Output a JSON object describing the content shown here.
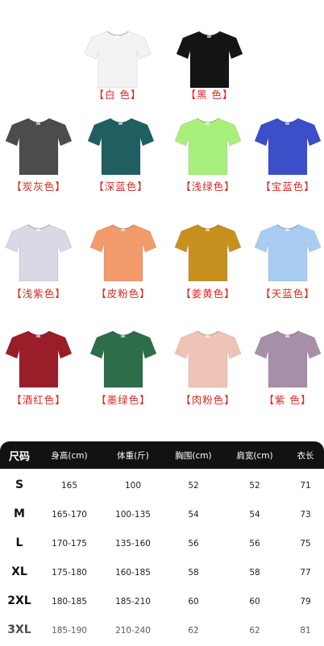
{
  "colors": [
    {
      "label": "【白 色】",
      "hex": "#f3f3f3"
    },
    {
      "label": "【黑 色】",
      "hex": "#141414"
    },
    {
      "label": "【炭灰色】",
      "hex": "#4c4c4c"
    },
    {
      "label": "【深蓝色】",
      "hex": "#1f5f62"
    },
    {
      "label": "【浅绿色】",
      "hex": "#a8ef7c"
    },
    {
      "label": "【宝蓝色】",
      "hex": "#3a4fc8"
    },
    {
      "label": "【浅紫色】",
      "hex": "#d8d8e6"
    },
    {
      "label": "【皮粉色】",
      "hex": "#f29a6a"
    },
    {
      "label": "【姜黄色】",
      "hex": "#c8901f"
    },
    {
      "label": "【天蓝色】",
      "hex": "#a9cdf2"
    },
    {
      "label": "【酒红色】",
      "hex": "#9a1d2a"
    },
    {
      "label": "【墨绿色】",
      "hex": "#2d6d4a"
    },
    {
      "label": "【肉粉色】",
      "hex": "#efc4b6"
    },
    {
      "label": "【紫 色】",
      "hex": "#a88fa8"
    }
  ],
  "size_table": {
    "headers": [
      "尺码",
      "身高(cm)",
      "体重(斤)",
      "胸围(cm)",
      "肩宽(cm)",
      "衣长"
    ],
    "rows": [
      [
        "S",
        "165",
        "100",
        "52",
        "52",
        "71"
      ],
      [
        "M",
        "165-170",
        "100-135",
        "54",
        "54",
        "73"
      ],
      [
        "L",
        "170-175",
        "135-160",
        "56",
        "56",
        "75"
      ],
      [
        "XL",
        "175-180",
        "160-185",
        "58",
        "58",
        "77"
      ],
      [
        "2XL",
        "180-185",
        "185-210",
        "60",
        "60",
        "79"
      ],
      [
        "3XL",
        "185-190",
        "210-240",
        "62",
        "62",
        "81"
      ]
    ]
  }
}
